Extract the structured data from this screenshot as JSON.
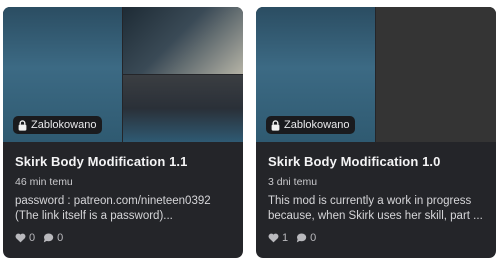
{
  "cards": [
    {
      "badge": "Zablokowano",
      "title": "Skirk Body Modification 1.1",
      "time": "46 min temu",
      "description": [
        "password : patreon.com/nineteen0392",
        "(The link itself is a password)..."
      ],
      "likes": "0",
      "comments": "0"
    },
    {
      "badge": "Zablokowano",
      "title": "Skirk Body Modification 1.0",
      "time": "3 dni temu",
      "description": [
        "This mod is currently a work in progress",
        "because, when Skirk uses her skill, part ..."
      ],
      "likes": "1",
      "comments": "0"
    }
  ],
  "icons": {
    "lock": "lock-icon",
    "like": "heart-icon",
    "comment": "comment-bubble-icon"
  },
  "colors": {
    "card_bg": "#242529",
    "badge_bg": "#1a1b1e",
    "text_primary": "#f4f4f5",
    "text_muted": "#c9c9cc"
  }
}
